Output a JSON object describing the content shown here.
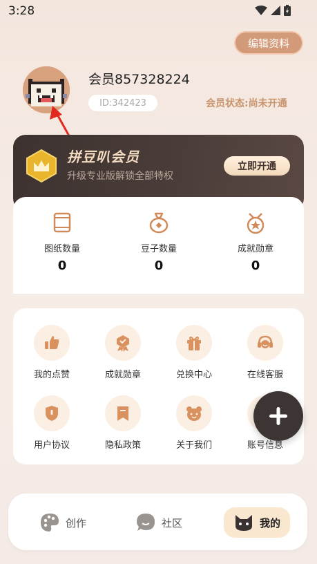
{
  "status_bar": {
    "time": "3:28"
  },
  "profile": {
    "edit_button": "编辑资料",
    "username": "会员857328224",
    "id": "ID:342423",
    "member_status": "会员状态:尚未开通"
  },
  "vip": {
    "title": "拼豆叭会员",
    "subtitle": "升级专业版解锁全部特权",
    "button": "立即开通"
  },
  "stats": [
    {
      "label": "图纸数量",
      "value": "0",
      "icon": "scroll-icon"
    },
    {
      "label": "豆子数量",
      "value": "0",
      "icon": "money-bag-icon"
    },
    {
      "label": "成就勋章",
      "value": "0",
      "icon": "medal-icon"
    }
  ],
  "menu": [
    {
      "label": "我的点赞",
      "icon": "thumbs-up-icon"
    },
    {
      "label": "成就勋章",
      "icon": "ribbon-badge-icon"
    },
    {
      "label": "兑换中心",
      "icon": "gift-icon"
    },
    {
      "label": "在线客服",
      "icon": "headset-icon"
    },
    {
      "label": "用户协议",
      "icon": "shield-icon"
    },
    {
      "label": "隐私政策",
      "icon": "bookmark-icon"
    },
    {
      "label": "关于我们",
      "icon": "bear-face-icon"
    },
    {
      "label": "账号信息",
      "icon": "account-icon"
    }
  ],
  "nav": [
    {
      "label": "创作",
      "icon": "palette-icon"
    },
    {
      "label": "社区",
      "icon": "chat-bubble-icon"
    },
    {
      "label": "我的",
      "icon": "cat-face-icon"
    }
  ],
  "colors": {
    "accent": "#d29a79",
    "gold_text": "#c8946d",
    "icon_orange": "#d9925f",
    "dark_card": "#3d3230",
    "nav_active_bg": "#fae7cf"
  }
}
